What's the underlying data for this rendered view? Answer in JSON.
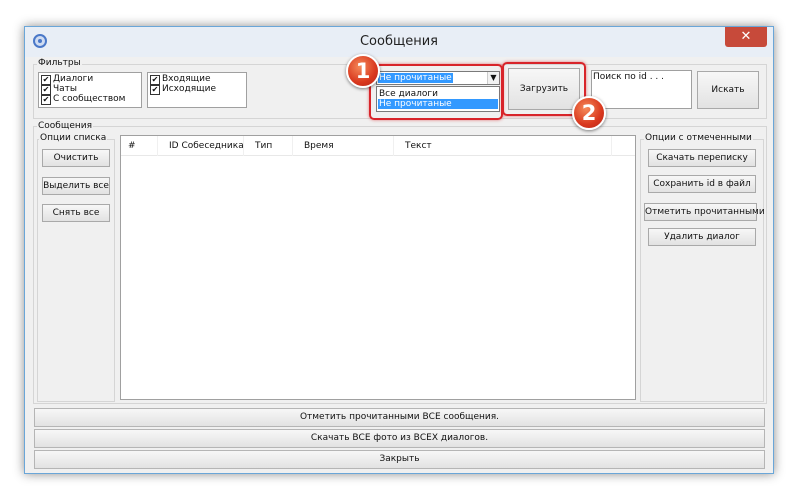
{
  "window": {
    "title": "Сообщения",
    "close_glyph": "✕"
  },
  "filters": {
    "group_label": "Фильтры",
    "left_checks": [
      {
        "label": "Диалоги",
        "checked": true
      },
      {
        "label": "Чаты",
        "checked": true
      },
      {
        "label": "С сообществом",
        "checked": true
      }
    ],
    "right_checks": [
      {
        "label": "Входящие",
        "checked": true
      },
      {
        "label": "Исходящие",
        "checked": true
      }
    ],
    "dropdown": {
      "selected": "Не прочитаные",
      "options": [
        "Все диалоги",
        "Не прочитаные"
      ],
      "highlighted": "Не прочитаные"
    },
    "load_button": "Загрузить",
    "search_placeholder": "Поиск по id . . .",
    "search_button": "Искать"
  },
  "messages": {
    "group_label": "Сообщения",
    "list_options_label": "Опции списка",
    "list_buttons": [
      "Очистить",
      "Выделить все",
      "Снять все"
    ],
    "columns": [
      "#",
      "ID Собеседника",
      "Тип",
      "Время",
      "Текст"
    ],
    "marked_options_label": "Опции с отмеченными",
    "marked_buttons": [
      "Скачать переписку",
      "Сохранить id в файл",
      "Отметить прочитанными",
      "Удалить диалог"
    ]
  },
  "bottom_buttons": [
    "Отметить прочитанными ВСЕ сообщения.",
    "Скачать ВСЕ фото из ВСЕХ диалогов.",
    "Закрыть"
  ],
  "annotations": {
    "badge1": "1",
    "badge2": "2"
  },
  "colors": {
    "accent_red": "#d8242a",
    "selection_blue": "#3399ff",
    "close_red": "#c74a3a"
  }
}
